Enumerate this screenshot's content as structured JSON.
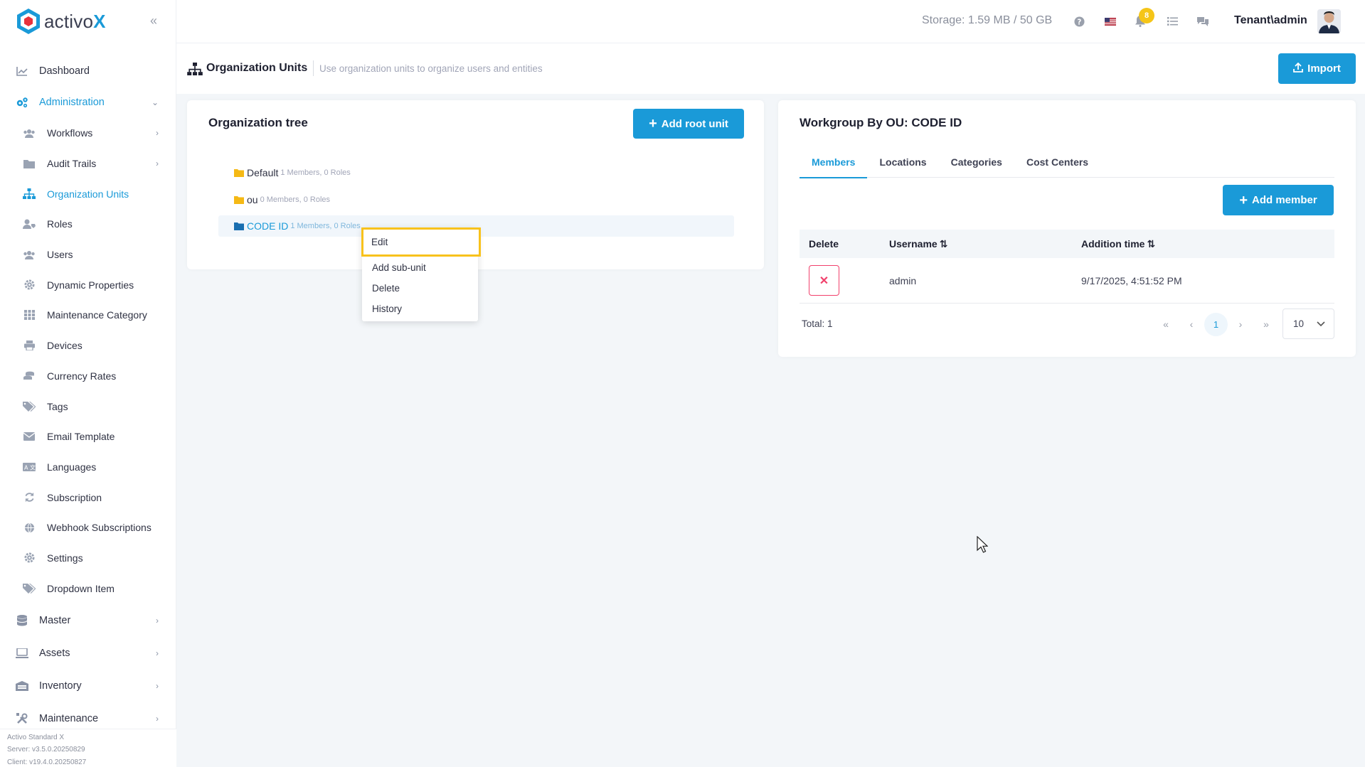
{
  "brand": {
    "name_prefix": "activo",
    "name_suffix": "X"
  },
  "sidebar": {
    "items": [
      {
        "label": "Dashboard",
        "icon": "chart-line-icon"
      },
      {
        "label": "Administration",
        "icon": "cogs-icon"
      }
    ],
    "admin_children": [
      {
        "label": "Workflows",
        "icon": "users-icon",
        "has_children": true
      },
      {
        "label": "Audit Trails",
        "icon": "folder-icon",
        "has_children": true
      },
      {
        "label": "Organization Units",
        "icon": "sitemap-icon",
        "active": true
      },
      {
        "label": "Roles",
        "icon": "user-tag-icon"
      },
      {
        "label": "Users",
        "icon": "users-icon"
      },
      {
        "label": "Dynamic Properties",
        "icon": "gear-icon"
      },
      {
        "label": "Maintenance Category",
        "icon": "grid-icon"
      },
      {
        "label": "Devices",
        "icon": "printer-icon"
      },
      {
        "label": "Currency Rates",
        "icon": "coins-icon"
      },
      {
        "label": "Tags",
        "icon": "tags-icon"
      },
      {
        "label": "Email Template",
        "icon": "envelope-icon"
      },
      {
        "label": "Languages",
        "icon": "language-icon"
      },
      {
        "label": "Subscription",
        "icon": "refresh-icon"
      },
      {
        "label": "Webhook Subscriptions",
        "icon": "globe-icon"
      },
      {
        "label": "Settings",
        "icon": "gear-icon"
      },
      {
        "label": "Dropdown Item",
        "icon": "tags-icon"
      }
    ],
    "bottom_items": [
      {
        "label": "Master",
        "icon": "database-icon"
      },
      {
        "label": "Assets",
        "icon": "laptop-icon"
      },
      {
        "label": "Inventory",
        "icon": "warehouse-icon"
      },
      {
        "label": "Maintenance",
        "icon": "tools-icon"
      }
    ],
    "footer": {
      "product": "Activo Standard X",
      "server": "Server: v3.5.0.20250829",
      "client": "Client: v19.4.0.20250827"
    }
  },
  "header": {
    "storage": "Storage: 1.59 MB / 50 GB",
    "notifications_count": "8",
    "user": "Tenant\\admin"
  },
  "subheader": {
    "title": "Organization Units",
    "description": "Use organization units to organize users and entities",
    "import_label": "Import"
  },
  "tree": {
    "title": "Organization tree",
    "add_root_label": "Add root unit",
    "nodes": [
      {
        "name": "Default",
        "meta": "1 Members, 0 Roles"
      },
      {
        "name": "ou",
        "meta": "0 Members, 0 Roles"
      },
      {
        "name": "CODE ID",
        "meta": "1 Members, 0 Roles"
      }
    ]
  },
  "context_menu": {
    "items": [
      "Edit",
      "Add sub-unit",
      "Delete",
      "History"
    ]
  },
  "workgroup": {
    "title": "Workgroup By OU: CODE ID",
    "tabs": [
      "Members",
      "Locations",
      "Categories",
      "Cost Centers"
    ],
    "add_member_label": "Add member",
    "columns": [
      "Delete",
      "Username",
      "Addition time"
    ],
    "rows": [
      {
        "username": "admin",
        "addition_time": "9/17/2025, 4:51:52 PM"
      }
    ],
    "total": "Total: 1",
    "current_page": "1",
    "page_size": "10"
  },
  "colors": {
    "primary": "#1a9ad8",
    "highlight": "#f8c21c",
    "danger": "#f1416c",
    "folder": "#f5b915"
  }
}
